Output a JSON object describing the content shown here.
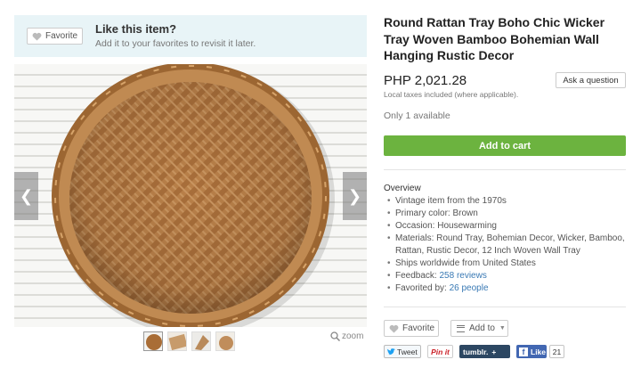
{
  "banner": {
    "favorite_label": "Favorite",
    "title": "Like this item?",
    "subtitle": "Add it to your favorites to revisit it later."
  },
  "gallery": {
    "thumbnail_count": 4,
    "zoom_label": "zoom"
  },
  "listing": {
    "title": "Round Rattan Tray Boho Chic Wicker Tray Woven Bamboo Bohemian Wall Hanging Rustic Decor",
    "price": "PHP 2,021.28",
    "tax_note": "Local taxes included (where applicable).",
    "ask_label": "Ask a question",
    "availability": "Only 1 available",
    "cart_label": "Add to cart"
  },
  "overview": {
    "heading": "Overview",
    "items": [
      "Vintage item from the 1970s",
      "Primary color: Brown",
      "Occasion: Housewarming",
      "Materials: Round Tray, Bohemian Decor, Wicker, Bamboo, Rattan, Rustic Decor, 12 Inch Woven Wall Tray",
      "Ships worldwide from United States"
    ],
    "feedback_prefix": "Feedback: ",
    "feedback_link": "258 reviews",
    "favorited_prefix": "Favorited by: ",
    "favorited_link": "26 people"
  },
  "actions": {
    "favorite_label": "Favorite",
    "add_to_label": "Add to"
  },
  "social": {
    "tweet": "Tweet",
    "pinit": "Pin it",
    "tumblr": "tumblr.",
    "tumblr_plus": "+",
    "like": "Like",
    "like_count": "21"
  },
  "colors": {
    "banner_bg": "#e8f4f7",
    "cart_green": "#6cb33f",
    "link_blue": "#3979b4",
    "tray_brown": "#b07a42"
  }
}
